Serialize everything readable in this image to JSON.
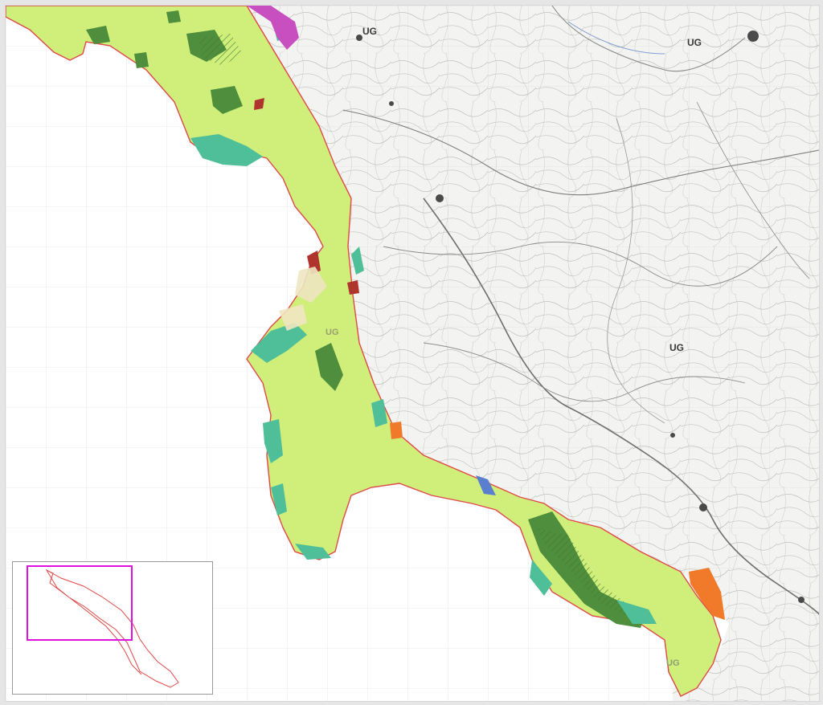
{
  "map": {
    "title": "",
    "labels": [
      {
        "id": "ug-north-1",
        "text": "UG"
      },
      {
        "id": "ug-north-2",
        "text": "UG"
      },
      {
        "id": "ug-coast",
        "text": "UG"
      },
      {
        "id": "ug-center",
        "text": "UG"
      },
      {
        "id": "ug-south",
        "text": "UG"
      }
    ],
    "colors": {
      "zone_light_green": "#cfee7a",
      "zone_dark_green": "#4e8e3c",
      "zone_teal": "#4fbf9a",
      "zone_magenta": "#c84fc0",
      "zone_orange": "#f07a2a",
      "zone_red": "#b0342e",
      "boundary": "#e04848",
      "topo_lines": "#9a9a9a",
      "grid": "#cfcfcf",
      "inset_frame": "#e010e0",
      "inset_outline": "#e04848"
    }
  },
  "inset": {
    "title": ""
  }
}
